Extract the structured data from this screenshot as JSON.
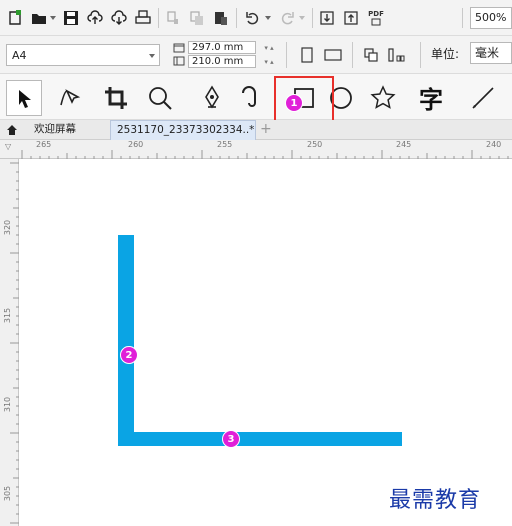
{
  "standard_toolbar": {
    "icons": [
      "new-document-icon",
      "open-folder-icon",
      "save-icon",
      "cloud-upload-icon",
      "cloud-download-icon",
      "print-icon",
      "cut-icon",
      "copy-icon",
      "paste-icon",
      "undo-icon",
      "redo-icon",
      "import-icon",
      "export-icon",
      "pdf-icon"
    ],
    "pdf_label": "PDF",
    "zoom_value": "500%"
  },
  "property_bar": {
    "page_size": "A4",
    "width": "297.0 mm",
    "height": "210.0 mm",
    "unit_label": "单位:",
    "unit_value": "毫米"
  },
  "toolbox": {
    "tools": [
      "pick-tool-icon",
      "shape-tool-icon",
      "crop-tool-icon",
      "zoom-tool-icon",
      "pen-tool-icon",
      "artistic-media-tool-icon",
      "rectangle-tool-icon",
      "ellipse-tool-icon",
      "polygon-tool-icon",
      "text-tool-icon",
      "line-tool-icon"
    ],
    "text_tool_glyph": "字"
  },
  "tabs": {
    "home_label": "欢迎屏幕",
    "document_label": "2531170_23373302334..*",
    "add_label": "+"
  },
  "rulers": {
    "horizontal_labels": [
      "265",
      "260",
      "255",
      "250",
      "245",
      "240"
    ],
    "vertical_labels": [
      "320",
      "315",
      "310",
      "305"
    ],
    "corner_label": "▽"
  },
  "annotations": {
    "badge_1": "1",
    "badge_2": "2",
    "badge_3": "3"
  },
  "colors": {
    "shape_fill": "#0aa4e4",
    "highlight": "#e8302b",
    "badge": "#e020d8",
    "watermark": "#1a3aa8"
  },
  "watermark": "最需教育"
}
